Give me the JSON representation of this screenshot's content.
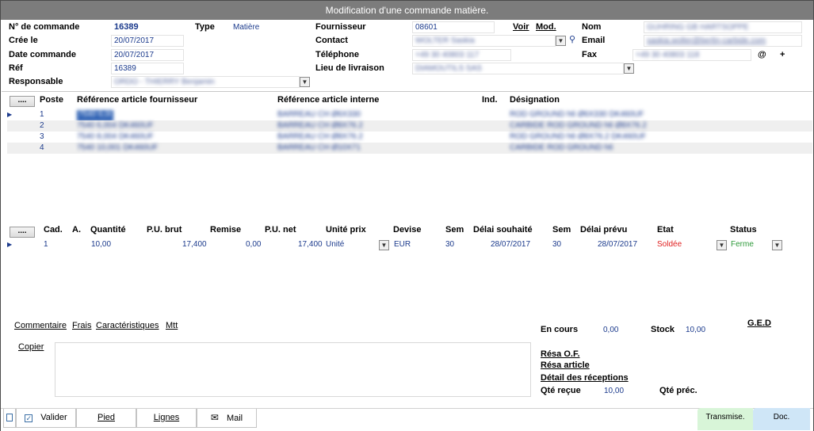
{
  "window": {
    "title": "Modification d'une commande matière."
  },
  "header": {
    "order_no_label": "N° de commande",
    "order_no": "16389",
    "type_label": "Type",
    "type": "Matière",
    "created_label": "Crée le",
    "created": "20/07/2017",
    "order_date_label": "Date commande",
    "order_date": "20/07/2017",
    "ref_label": "Réf",
    "ref": "16389",
    "responsible_label": "Responsable",
    "responsible": "ORDO - THIERRY Benjamin",
    "supplier_label": "Fournisseur",
    "supplier": "08601",
    "view_link": "Voir",
    "modify_link": "Mod.",
    "contact_label": "Contact",
    "contact": "WOLTER Saskia",
    "phone_label": "Téléphone",
    "phone": "+49 30 40803 117",
    "delivery_label": "Lieu de livraison",
    "delivery": "DIAMOUTILS SAS",
    "name_label": "Nom",
    "name": "GUHRING GB HARTSOPPE",
    "email_label": "Email",
    "email": "saskia.wolter@berlin-carbide.com",
    "fax_label": "Fax",
    "fax": "+49 30 40803 118",
    "at_sign": "@",
    "plus_sign": "+"
  },
  "lines_table": {
    "button": "....",
    "headers": [
      "Poste",
      "Référence article fournisseur",
      "Référence article interne",
      "Ind.",
      "Désignation"
    ],
    "rows": [
      {
        "poste": "1",
        "ref_fournisseur": "7540 6,004 DK460UF",
        "ref_interne": "BARREAU CH Ø6X330",
        "ind": "",
        "designation": "ROD GROUND h6 Ø6X330 DK460UF"
      },
      {
        "poste": "2",
        "ref_fournisseur": "7540 6,004 DK460UF",
        "ref_interne": "BARREAU CH Ø8X76.2",
        "ind": "",
        "designation": "CARBIDE ROD GROUND h6 Ø8X76.2"
      },
      {
        "poste": "3",
        "ref_fournisseur": "7540 8,004 DK460UF",
        "ref_interne": "BARREAU CH Ø8X76.2",
        "ind": "",
        "designation": "ROD GROUND h6 Ø8X76.2 DK460UF"
      },
      {
        "poste": "4",
        "ref_fournisseur": "7540 10,001 DK460UF",
        "ref_interne": "BARREAU CH Ø10X71",
        "ind": "",
        "designation": "CARBIDE ROD GROUND h6"
      }
    ]
  },
  "cadence_table": {
    "button": "....",
    "headers": [
      "Cad.",
      "A.",
      "Quantité",
      "P.U. brut",
      "Remise",
      "P.U. net",
      "Unité prix",
      "Devise",
      "Sem",
      "Délai souhaité",
      "Sem",
      "Délai prévu",
      "Etat",
      "Status"
    ],
    "row": {
      "cad": "1",
      "a": "",
      "quantite": "10,00",
      "pu_brut": "17,400",
      "remise": "0,00",
      "pu_net": "17,400",
      "unite_prix": "Unité",
      "devise": "EUR",
      "sem1": "30",
      "delai_souhaite": "28/07/2017",
      "sem2": "30",
      "delai_prevu": "28/07/2017",
      "etat": "Soldée",
      "status": "Ferme"
    }
  },
  "links": {
    "commentaire": "Commentaire",
    "frais": "Frais",
    "caracteristiques": "Caractéristiques",
    "mtt": "Mtt",
    "copier": "Copier",
    "ged": "G.E.D",
    "resa_of": "Résa O.F.",
    "resa_article": "Résa article",
    "detail_receptions": "Détail des réceptions"
  },
  "stats": {
    "en_cours_label": "En cours",
    "en_cours": "0,00",
    "stock_label": "Stock",
    "stock": "10,00",
    "qte_recue_label": "Qté reçue",
    "qte_recue": "10,00",
    "qte_prec_label": "Qté préc."
  },
  "footer": {
    "valider": "Valider",
    "pied": "Pied",
    "lignes": "Lignes",
    "mail": "Mail",
    "transmise": "Transmise.",
    "doc": "Doc."
  },
  "colors": {
    "value_blue": "#1b3a8c",
    "etat_red": "#e02020",
    "status_green": "#2e9a3a",
    "transmise_bg": "#d8f5d8",
    "doc_bg": "#cfe6f7"
  }
}
